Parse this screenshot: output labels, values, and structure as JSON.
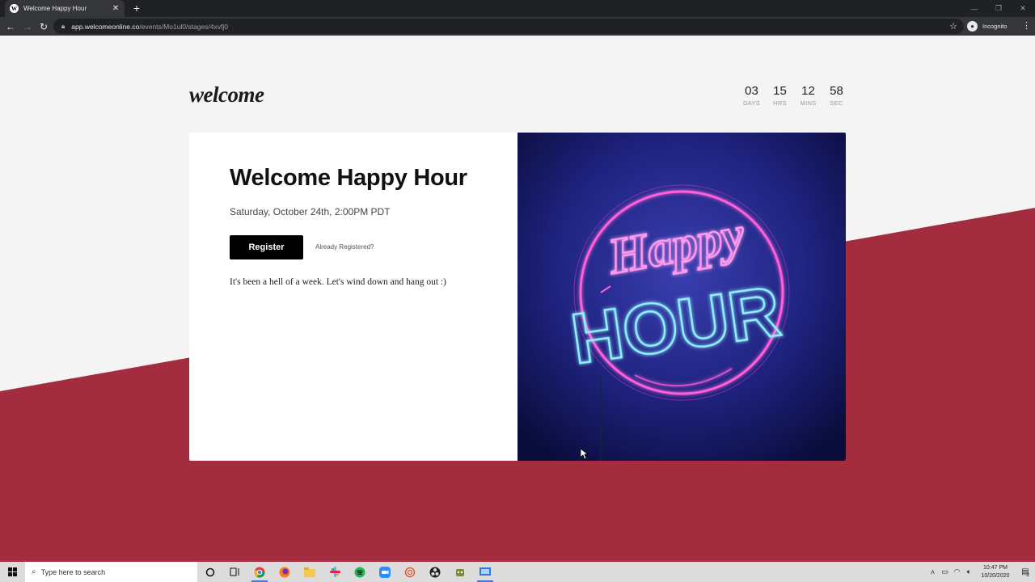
{
  "browser": {
    "tab_title": "Welcome Happy Hour",
    "favicon_letter": "W",
    "url_host": "app.welcomeonline.co",
    "url_path": "/events/Mo1ul0/stages/4xvfj0",
    "profile_label": "Incognito"
  },
  "header": {
    "logo": "welcome",
    "countdown": [
      {
        "value": "03",
        "label": "DAYS"
      },
      {
        "value": "15",
        "label": "HRS"
      },
      {
        "value": "12",
        "label": "MINS"
      },
      {
        "value": "58",
        "label": "SEC"
      }
    ]
  },
  "event": {
    "title": "Welcome Happy Hour",
    "date": "Saturday, October 24th, 2:00PM PDT",
    "register_label": "Register",
    "already_registered": "Already Registered?",
    "description": "It's been a hell of a week. Let's wind down and hang out :)",
    "image_text_top": "Happy",
    "image_text_bottom": "HOUR"
  },
  "taskbar": {
    "search_placeholder": "Type here to search",
    "time": "10:47 PM",
    "date": "10/20/2020",
    "notification_count": "2"
  },
  "colors": {
    "accent": "#a32c3e",
    "neon_pink": "#ff5fd8",
    "neon_blue": "#6fe3ff",
    "card_bg": "#1a1f6e"
  }
}
